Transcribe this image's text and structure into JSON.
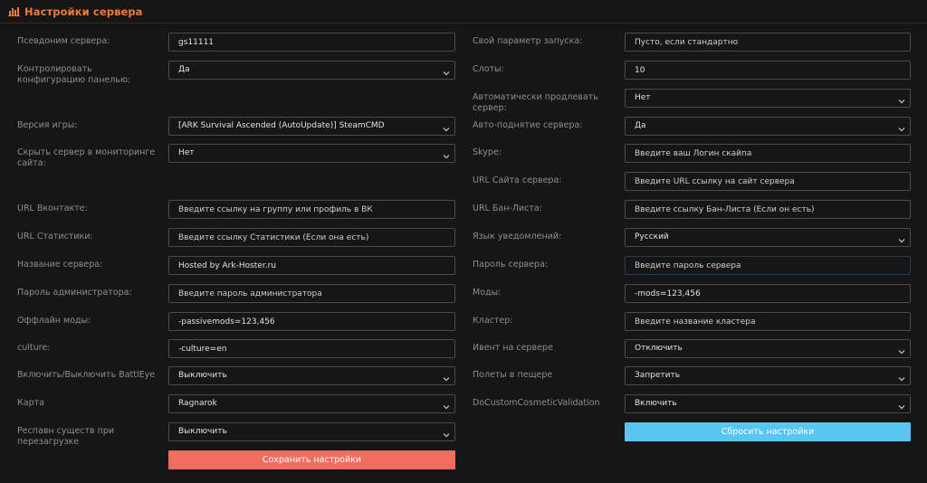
{
  "header": {
    "title": "Настройки сервера",
    "icon": "bar-chart-icon",
    "accent": "#f07a3a"
  },
  "left": [
    {
      "label": "Псевдоним сервера:",
      "type": "input",
      "value": "gs11111",
      "placeholder": ""
    },
    {
      "label": "Контролировать конфигурацию панелью:",
      "type": "select",
      "value": "Да"
    },
    {
      "label": "Версия игры:",
      "type": "select",
      "value": "[ARK Survival Ascended (AutoUpdate)] SteamCMD"
    },
    {
      "label": "Скрыть сервер в мониторинге сайта:",
      "type": "select",
      "value": "Нет"
    },
    {
      "label": "URL Вконтакте:",
      "type": "input",
      "value": "",
      "placeholder": "Введите ссылку на группу или профиль в ВК"
    },
    {
      "label": "URL Статистики:",
      "type": "input",
      "value": "",
      "placeholder": "Введите ссылку Статистики (Если она есть)"
    },
    {
      "label": "Название сервера:",
      "type": "input",
      "value": "Hosted by Ark-Hoster.ru",
      "placeholder": ""
    },
    {
      "label": "Пароль администратора:",
      "type": "input",
      "value": "",
      "placeholder": "Введите пароль администратора"
    },
    {
      "label": "Оффлайн моды:",
      "type": "input",
      "value": "-passivemods=123,456",
      "placeholder": ""
    },
    {
      "label": "culture:",
      "type": "input",
      "value": "-culture=en",
      "placeholder": ""
    },
    {
      "label": "Включить/Выключить BattlEye",
      "type": "select",
      "value": "Выключить"
    },
    {
      "label": "Карта",
      "type": "select",
      "value": "Ragnarok"
    },
    {
      "label": "Респавн существ при перезагрузке",
      "type": "select",
      "value": "Выключить"
    }
  ],
  "right": [
    {
      "label": "Свой параметр запуска:",
      "type": "input",
      "value": "",
      "placeholder": "Пусто, если стандартно"
    },
    {
      "label": "Слоты:",
      "type": "input",
      "value": "10",
      "placeholder": ""
    },
    {
      "label": "Автоматически продлевать сервер:",
      "type": "select",
      "value": "Нет"
    },
    {
      "label": "Авто-поднятие сервера:",
      "type": "select",
      "value": "Да"
    },
    {
      "label": "Skype:",
      "type": "input",
      "value": "",
      "placeholder": "Введите ваш Логин скайпа"
    },
    {
      "label": "URL Сайта сервера:",
      "type": "input",
      "value": "",
      "placeholder": "Введите URL ссылку на сайт сервера"
    },
    {
      "label": "URL Бан-Листа:",
      "type": "input",
      "value": "",
      "placeholder": "Введите ссылку Бан-Листа (Если он есть)"
    },
    {
      "label": "Язык уведомлений:",
      "type": "select",
      "value": "Русский"
    },
    {
      "label": "Пароль сервера:",
      "type": "input",
      "value": "",
      "placeholder": "Введите пароль сервера"
    },
    {
      "label": "Моды:",
      "type": "input",
      "value": "-mods=123,456",
      "placeholder": ""
    },
    {
      "label": "Кластер:",
      "type": "input",
      "value": "",
      "placeholder": "Введите название кластера"
    },
    {
      "label": "Ивент на сервере",
      "type": "select",
      "value": "Отключить"
    },
    {
      "label": "Полеты в пещере",
      "type": "select",
      "value": "Запретить"
    },
    {
      "label": "DoCustomCosmeticValidation",
      "type": "select",
      "value": "Включить"
    }
  ],
  "buttons": {
    "save_label": "Сохранить настройки",
    "reset_label": "Сбросить настройки",
    "save_color": "#f26d5f",
    "reset_color": "#58c6ee"
  }
}
